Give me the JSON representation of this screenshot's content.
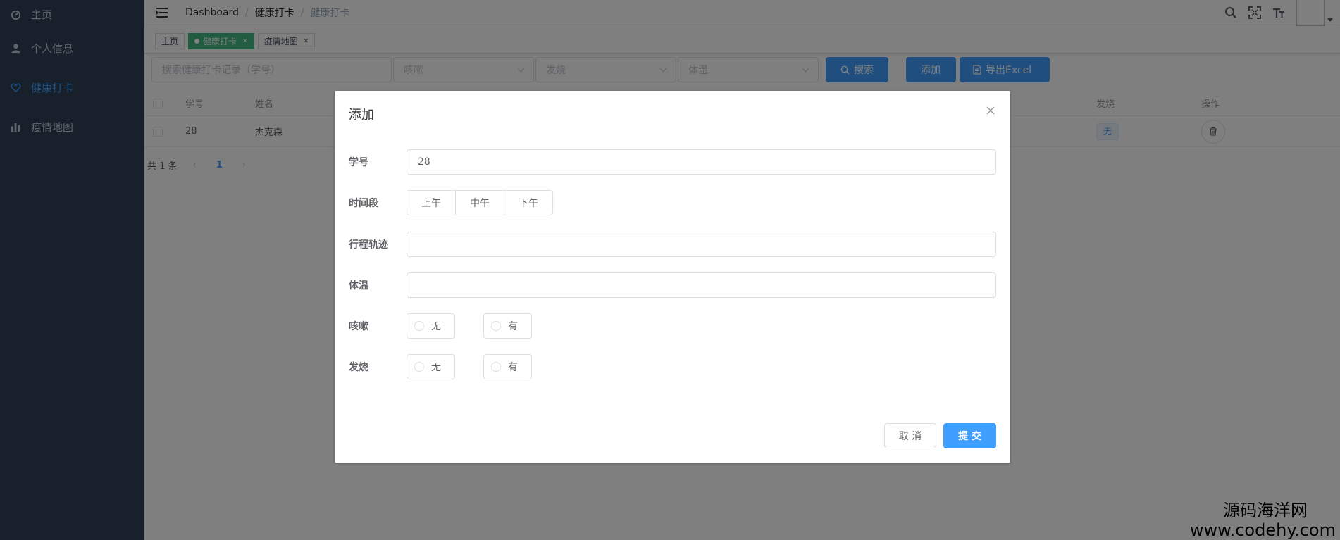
{
  "sidebar": {
    "items": [
      {
        "label": "主页",
        "icon": "dashboard-icon"
      },
      {
        "label": "个人信息",
        "icon": "user-icon"
      },
      {
        "label": "健康打卡",
        "icon": "heart-icon",
        "active": true
      },
      {
        "label": "疫情地图",
        "icon": "chart-icon"
      }
    ]
  },
  "navbar": {
    "breadcrumb": [
      "Dashboard",
      "健康打卡",
      "健康打卡"
    ]
  },
  "tags": [
    {
      "label": "主页"
    },
    {
      "label": "健康打卡",
      "active": true
    },
    {
      "label": "疫情地图"
    }
  ],
  "filters": {
    "search_placeholder": "搜索健康打卡记录（学号）",
    "cough_placeholder": "咳嗽",
    "fever_placeholder": "发烧",
    "temp_placeholder": "体温",
    "search_button": "搜索",
    "add_button": "添加",
    "export_button": "导出Excel"
  },
  "table": {
    "headers": {
      "id": "学号",
      "name": "姓名",
      "fever": "发烧",
      "ops": "操作"
    },
    "rows": [
      {
        "id": "28",
        "name": "杰克森",
        "fever": "无"
      }
    ]
  },
  "pagination": {
    "total": "共 1 条",
    "current": "1"
  },
  "dialog": {
    "title": "添加",
    "fields": {
      "id_label": "学号",
      "id_value": "28",
      "period_label": "时间段",
      "periods": [
        "上午",
        "中午",
        "下午"
      ],
      "track_label": "行程轨迹",
      "temp_label": "体温",
      "cough_label": "咳嗽",
      "fever_label": "发烧",
      "options": [
        "无",
        "有"
      ]
    },
    "cancel": "取 消",
    "submit": "提 交"
  },
  "watermark": {
    "line1": "源码海洋网",
    "line2": "www.codehy.com"
  },
  "colors": {
    "sidebar_bg": "#304156",
    "primary": "#409eff",
    "tag_active": "#42b983"
  }
}
